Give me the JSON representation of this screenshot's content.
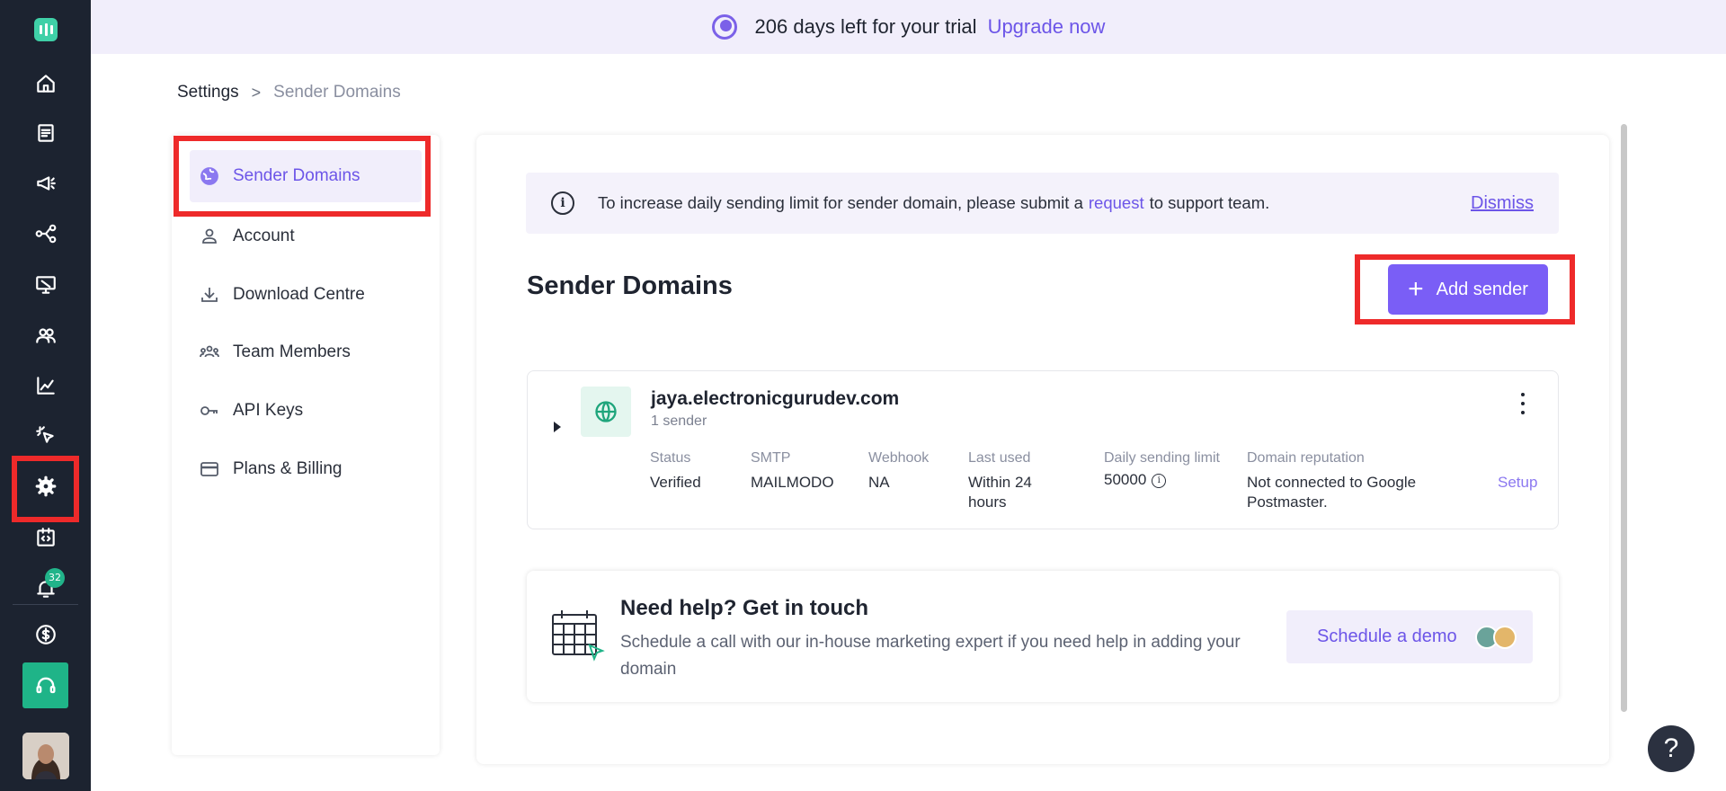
{
  "banner": {
    "trial_text": "206 days left for your trial",
    "upgrade_label": "Upgrade now"
  },
  "rail": {
    "icons": [
      "home-icon",
      "document-icon",
      "megaphone-icon",
      "journey-icon",
      "screen-icon",
      "contacts-icon",
      "analytics-icon",
      "click-icon",
      "settings-icon",
      "code-icon",
      "bell-icon",
      "billing-icon",
      "headset-icon"
    ],
    "notification_count": "32"
  },
  "breadcrumb": {
    "root": "Settings",
    "separator": ">",
    "current": "Sender Domains"
  },
  "settings_nav": {
    "items": [
      {
        "label": "Sender Domains",
        "icon": "globe-icon",
        "active": true
      },
      {
        "label": "Account",
        "icon": "user-icon"
      },
      {
        "label": "Download Centre",
        "icon": "download-icon"
      },
      {
        "label": "Team Members",
        "icon": "team-icon"
      },
      {
        "label": "API Keys",
        "icon": "key-icon"
      },
      {
        "label": "Plans & Billing",
        "icon": "card-icon"
      }
    ]
  },
  "info_bar": {
    "text_before": "To increase daily sending limit for sender domain, please submit a",
    "link": "request",
    "text_after": "to support team.",
    "dismiss": "Dismiss"
  },
  "main": {
    "title": "Sender Domains",
    "add_button": "Add sender"
  },
  "domain": {
    "name": "jaya.electronicgurudev.com",
    "senders": "1 sender",
    "columns": [
      {
        "label": "Status",
        "value": "Verified"
      },
      {
        "label": "SMTP",
        "value": "MAILMODO"
      },
      {
        "label": "Webhook",
        "value": "NA"
      },
      {
        "label": "Last used",
        "value": "Within 24 hours"
      },
      {
        "label": "Daily sending limit",
        "value": "50000"
      },
      {
        "label": "Domain reputation",
        "value": "Not connected to Google Postmaster."
      }
    ],
    "setup_label": "Setup"
  },
  "help": {
    "title": "Need help? Get in touch",
    "text": "Schedule a call with our in-house marketing expert if you need help in adding your domain",
    "button": "Schedule a demo"
  },
  "fab": {
    "label": "?"
  },
  "colors": {
    "accent": "#7a5ef6",
    "rail_bg": "#1c2330",
    "success": "#1fb488",
    "highlight_box": "#ee2a2a"
  }
}
